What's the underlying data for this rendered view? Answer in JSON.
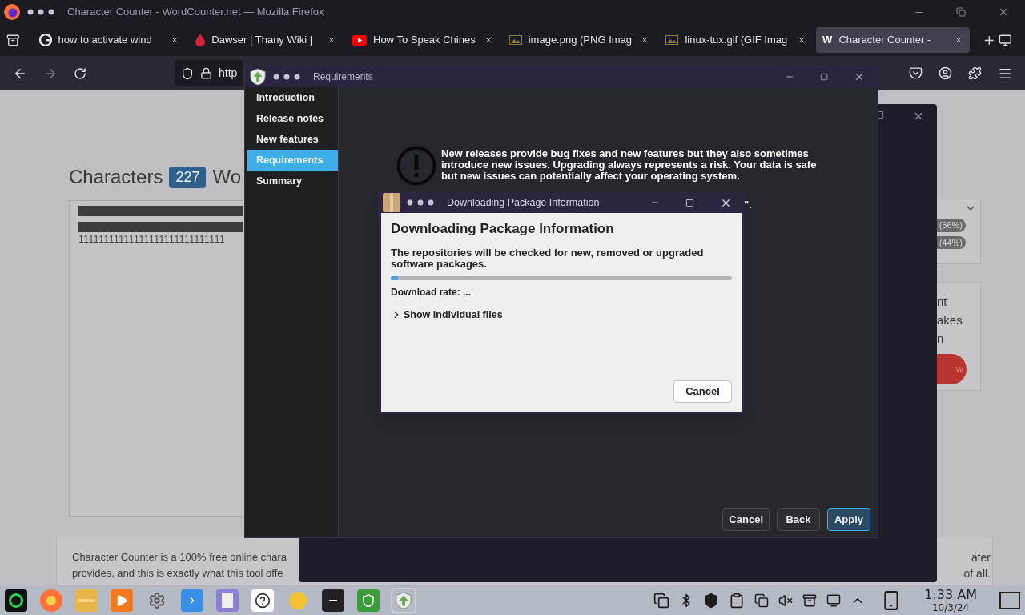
{
  "browser": {
    "title": "Character Counter - WordCounter.net — Mozilla Firefox",
    "tabs": [
      {
        "label": "how to activate wind",
        "selected": false,
        "kind": "google"
      },
      {
        "label": "Dawser | Thany Wiki |",
        "selected": false,
        "kind": "wiki"
      },
      {
        "label": "How To Speak Chines",
        "selected": false,
        "kind": "video"
      },
      {
        "label": "image.png (PNG Imag",
        "selected": false,
        "kind": "image"
      },
      {
        "label": "linux-tux.gif (GIF Imag",
        "selected": false,
        "kind": "image"
      },
      {
        "label": "Character Counter -",
        "selected": true,
        "kind": "w",
        "favicon": "W"
      }
    ],
    "url": "http"
  },
  "page": {
    "heading": "Characters",
    "count": "227",
    "heading_2": "Wo",
    "text": "11111111111111111111111111111",
    "stats": [
      "(56%)",
      "(44%)"
    ],
    "side_text": [
      "nt",
      "akes",
      "n"
    ],
    "side_button": "w",
    "paragraph": [
      "Character Counter is a 100% free online chara",
      "provides, and this is exactly what this tool offe"
    ],
    "paragraph_right": [
      "ater",
      "of all."
    ]
  },
  "requirements_window": {
    "title": "Requirements",
    "nav": [
      {
        "label": "Introduction",
        "selected": false
      },
      {
        "label": "Release notes",
        "selected": false
      },
      {
        "label": "New features",
        "selected": false
      },
      {
        "label": "Requirements",
        "selected": true
      },
      {
        "label": "Summary",
        "selected": false
      }
    ],
    "message": "New releases provide bug fixes and new features but they also sometimes introduce new issues. Upgrading always represents a risk. Your data is safe but new issues can potentially affect your operating system.",
    "message_tail": "\".",
    "buttons": [
      {
        "label": "Cancel",
        "default": false
      },
      {
        "label": "Back",
        "default": false
      },
      {
        "label": "Apply",
        "default": true
      }
    ]
  },
  "download_dialog": {
    "title": "Downloading Package Information",
    "heading": "Downloading Package Information",
    "description": "The repositories will be checked for new, removed or upgraded software packages.",
    "progress": {
      "level": 0.02
    },
    "rate": "Download rate: ...",
    "expander": {
      "label": "Show individual files",
      "expanded": false
    },
    "button": "Cancel"
  },
  "taskbar": {
    "time": "1:33 AM",
    "date": "10/3/24"
  }
}
